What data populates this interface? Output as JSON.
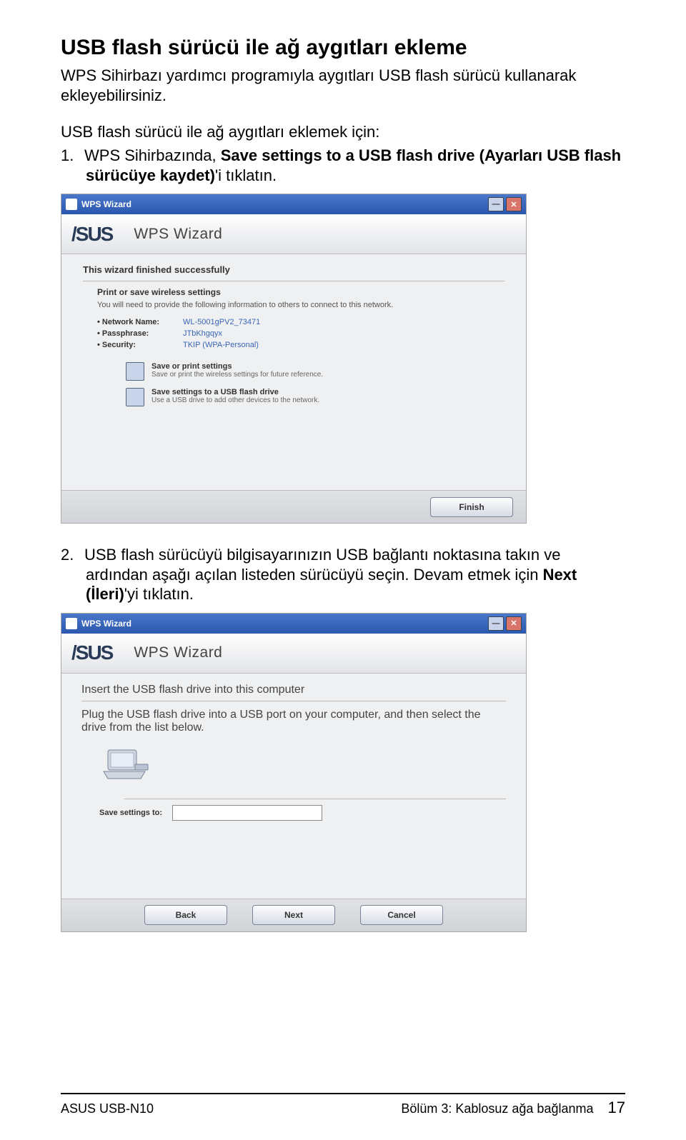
{
  "heading": "USB flash sürücü ile ağ aygıtları ekleme",
  "intro": "WPS Sihirbazı yardımcı programıyla aygıtları USB flash sürücü kullanarak ekleyebilirsiniz.",
  "subhead": "USB flash sürücü ile ağ aygıtları eklemek için:",
  "steps": [
    {
      "num": "1.",
      "pre": "WPS Sihirbazında, ",
      "bold": "Save settings to a USB flash drive (Ayarları USB flash sürücüye kaydet)",
      "post": "'i tıklatın."
    },
    {
      "num": "2.",
      "pre": "USB flash sürücüyü bilgisayarınızın USB bağlantı noktasına takın ve ardından aşağı açılan listeden sürücüyü seçin. Devam etmek için ",
      "bold": "Next (İleri)",
      "post": "'yi tıklatın."
    }
  ],
  "screenshot1": {
    "window_title": "WPS Wizard",
    "brand": "/SUS",
    "brand_subtitle": "WPS Wizard",
    "wizard_heading": "This wizard finished successfully",
    "wizard_sub": "Print or save wireless settings",
    "wizard_note": "You will need to provide the following information to others to connect to this network.",
    "rows": [
      {
        "k": "Network Name:",
        "v": "WL-5001gPV2_73471"
      },
      {
        "k": "Passphrase:",
        "v": "JTbKhgqyx"
      },
      {
        "k": "Security:",
        "v": "TKIP (WPA-Personal)"
      }
    ],
    "options": [
      {
        "title": "Save or print settings",
        "sub": "Save or print the wireless settings for future reference."
      },
      {
        "title": "Save settings to a USB flash drive",
        "sub": "Use a USB drive to add other devices to the network."
      }
    ],
    "buttons": {
      "finish": "Finish"
    }
  },
  "screenshot2": {
    "window_title": "WPS Wizard",
    "brand": "/SUS",
    "brand_subtitle": "WPS Wizard",
    "h": "Insert the USB flash drive into this computer",
    "note": "Plug the USB flash drive into a USB port on your computer, and then select the drive from the list below.",
    "save_label": "Save settings to:",
    "save_value": "",
    "buttons": {
      "back": "Back",
      "next": "Next",
      "cancel": "Cancel"
    }
  },
  "footer": {
    "left": "ASUS USB-N10",
    "right": "Bölüm 3:  Kablosuz ağa bağlanma",
    "page": "17"
  }
}
